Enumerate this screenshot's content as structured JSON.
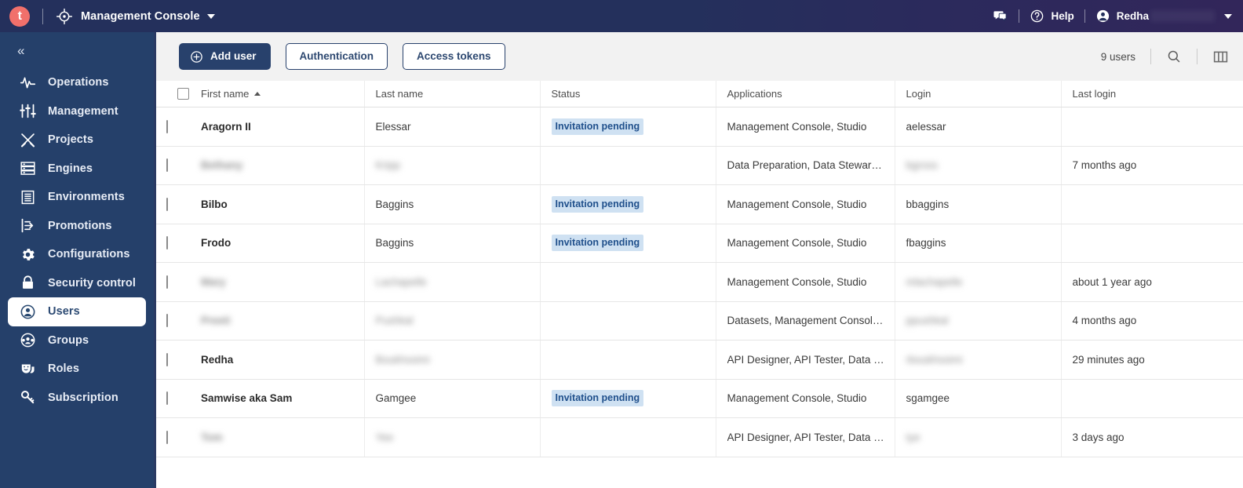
{
  "topbar": {
    "logo_letter": "t",
    "product_icon": "compass-target-icon",
    "title": "Management Console",
    "dropdown_icon": "chevron-down-icon",
    "chat_icon": "chat-bubbles-icon",
    "help_icon": "question-circle-icon",
    "help_label": "Help",
    "user_icon": "user-avatar-icon",
    "user_name": "Redha",
    "user_menu_icon": "chevron-down-icon"
  },
  "sidebar": {
    "collapse_icon": "chevron-double-left-icon",
    "collapse_label": "«",
    "items": [
      {
        "label": "Operations",
        "icon": "pulse-activity-icon",
        "active": false
      },
      {
        "label": "Management",
        "icon": "sliders-icon",
        "active": false
      },
      {
        "label": "Projects",
        "icon": "tools-cross-icon",
        "active": false
      },
      {
        "label": "Engines",
        "icon": "server-rack-icon",
        "active": false
      },
      {
        "label": "Environments",
        "icon": "document-lines-icon",
        "active": false
      },
      {
        "label": "Promotions",
        "icon": "promote-arrow-icon",
        "active": false
      },
      {
        "label": "Configurations",
        "icon": "gear-icon",
        "active": false
      },
      {
        "label": "Security control",
        "icon": "lock-icon",
        "active": false
      },
      {
        "label": "Users",
        "icon": "user-circle-icon",
        "active": true
      },
      {
        "label": "Groups",
        "icon": "users-group-icon",
        "active": false
      },
      {
        "label": "Roles",
        "icon": "theater-masks-icon",
        "active": false
      },
      {
        "label": "Subscription",
        "icon": "key-icon",
        "active": false
      }
    ]
  },
  "toolbar": {
    "add_user_label": "Add user",
    "add_user_icon": "plus-circle-icon",
    "authentication_label": "Authentication",
    "access_tokens_label": "Access tokens",
    "user_count": "9 users",
    "search_icon": "search-icon",
    "columns_icon": "columns-layout-icon"
  },
  "table": {
    "select_all_checkbox": "unchecked",
    "columns": [
      {
        "key": "first_name",
        "label": "First name",
        "sorted": "asc",
        "sort_icon": "sort-ascending-icon"
      },
      {
        "key": "last_name",
        "label": "Last name",
        "sorted": "none"
      },
      {
        "key": "status",
        "label": "Status",
        "sorted": "none"
      },
      {
        "key": "applications",
        "label": "Applications",
        "sorted": "none"
      },
      {
        "key": "login",
        "label": "Login",
        "sorted": "none"
      },
      {
        "key": "last_login",
        "label": "Last login",
        "sorted": "none"
      }
    ],
    "rows": [
      {
        "first_name": "Aragorn II",
        "first_name_blurred": false,
        "last_name": "Elessar",
        "last_name_blurred": false,
        "status": "Invitation pending",
        "applications": "Management Console, Studio",
        "login": "aelessar",
        "login_blurred": false,
        "last_login": ""
      },
      {
        "first_name": "Bethany",
        "first_name_blurred": true,
        "last_name": "Kripp",
        "last_name_blurred": true,
        "status": "",
        "applications": "Data Preparation, Data Stewards…",
        "login": "bgross",
        "login_blurred": true,
        "last_login": "7 months ago"
      },
      {
        "first_name": "Bilbo",
        "first_name_blurred": false,
        "last_name": "Baggins",
        "last_name_blurred": false,
        "status": "Invitation pending",
        "applications": "Management Console, Studio",
        "login": "bbaggins",
        "login_blurred": false,
        "last_login": ""
      },
      {
        "first_name": "Frodo",
        "first_name_blurred": false,
        "last_name": "Baggins",
        "last_name_blurred": false,
        "status": "Invitation pending",
        "applications": "Management Console, Studio",
        "login": "fbaggins",
        "login_blurred": false,
        "last_login": ""
      },
      {
        "first_name": "Mary",
        "first_name_blurred": true,
        "last_name": "Lachapelle",
        "last_name_blurred": true,
        "status": "",
        "applications": "Management Console, Studio",
        "login": "mlachapelle",
        "login_blurred": true,
        "last_login": "about 1 year ago"
      },
      {
        "first_name": "Preeti",
        "first_name_blurred": true,
        "last_name": "Pushkal",
        "last_name_blurred": true,
        "status": "",
        "applications": "Datasets, Management Console, …",
        "login": "ppushkal",
        "login_blurred": true,
        "last_login": "4 months ago"
      },
      {
        "first_name": "Redha",
        "first_name_blurred": false,
        "last_name": "Boukhssimi",
        "last_name_blurred": true,
        "status": "",
        "applications": "API Designer, API Tester, Data Inv…",
        "login": "rboukhssimi",
        "login_blurred": true,
        "last_login": "29 minutes ago"
      },
      {
        "first_name": "Samwise aka Sam",
        "first_name_blurred": false,
        "last_name": "Gamgee",
        "last_name_blurred": false,
        "status": "Invitation pending",
        "applications": "Management Console, Studio",
        "login": "sgamgee",
        "login_blurred": false,
        "last_login": ""
      },
      {
        "first_name": "Tom",
        "first_name_blurred": true,
        "last_name": "Yee",
        "last_name_blurred": true,
        "status": "",
        "applications": "API Designer, API Tester, Data Inv…",
        "login": "tye",
        "login_blurred": true,
        "last_login": "3 days ago"
      }
    ]
  },
  "colors": {
    "topbar_navy": "#24305c",
    "sidebar_blue": "#25406a",
    "primary_button": "#28416c",
    "accent_logo": "#f1706b",
    "badge_bg": "#cfe1f2",
    "badge_text": "#20508c"
  }
}
